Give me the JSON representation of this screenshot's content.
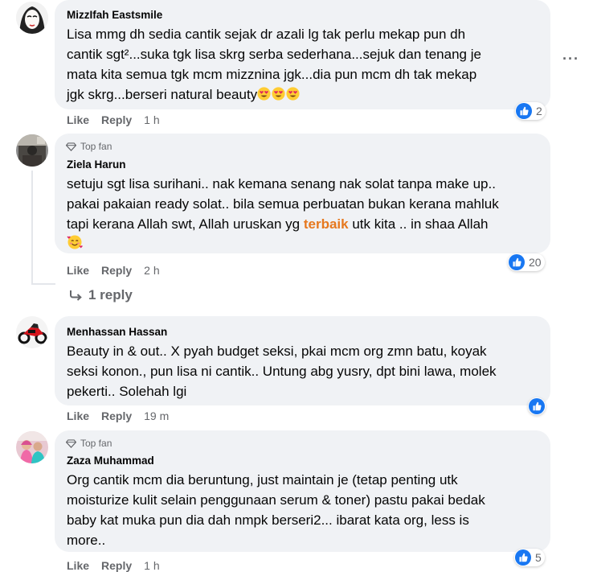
{
  "ui": {
    "like": "Like",
    "reply": "Reply",
    "top_fan": "Top fan"
  },
  "comments": [
    {
      "author": "MizzIfah Eastsmile",
      "top_fan": false,
      "lines": [
        "Lisa mmg dh sedia cantik sejak dr azali lg tak perlu mekap pun dh",
        "cantik sgt²...suka tgk lisa skrg serba sederhana...sejuk dan tenang je",
        "mata kita semua tgk mcm mizznina jgk...dia pun mcm dh tak mekap",
        "jgk skrg...berseri natural beauty"
      ],
      "emoji": "smiling-face-with-heart-eyes x3",
      "time": "1 h",
      "reaction_count": "2"
    },
    {
      "author": "Ziela Harun",
      "top_fan": true,
      "lines": [
        "setuju sgt lisa surihani.. nak kemana senang nak solat tanpa make up..",
        "pakai pakaian ready solat.. bila semua perbuatan bukan kerana mahluk",
        "tapi kerana Allah swt, Allah uruskan yg",
        "utk kita .. in shaa Allah"
      ],
      "highlight": "terbaik",
      "emoji": "smiling-face-with-hearts",
      "time": "2 h",
      "reaction_count": "20",
      "replies_label": "1 reply"
    },
    {
      "author": "Menhassan Hassan",
      "top_fan": false,
      "lines": [
        "Beauty in & out.. X pyah budget seksi, pkai mcm org zmn batu, koyak",
        "seksi konon., pun lisa ni cantik.. Untung abg yusry, dpt bini lawa, molek",
        "pekerti.. Solehah lgi"
      ],
      "time": "19 m",
      "reaction_count": ""
    },
    {
      "author": "Zaza Muhammad",
      "top_fan": true,
      "lines": [
        "Org cantik mcm dia beruntung, just maintain je (tetap penting utk",
        "moisturize kulit selain penggunaan serum & toner) pastu pakai bedak",
        "baby kat muka pun dia dah nmpk berseri2... ibarat kata org, less is",
        "more.."
      ],
      "time": "1 h",
      "reaction_count": "5"
    }
  ],
  "colors": {
    "bubble": "#f0f2f5",
    "like_blue": "#1877f2",
    "meta_gray": "#65676b",
    "highlight": "#e6781e"
  }
}
